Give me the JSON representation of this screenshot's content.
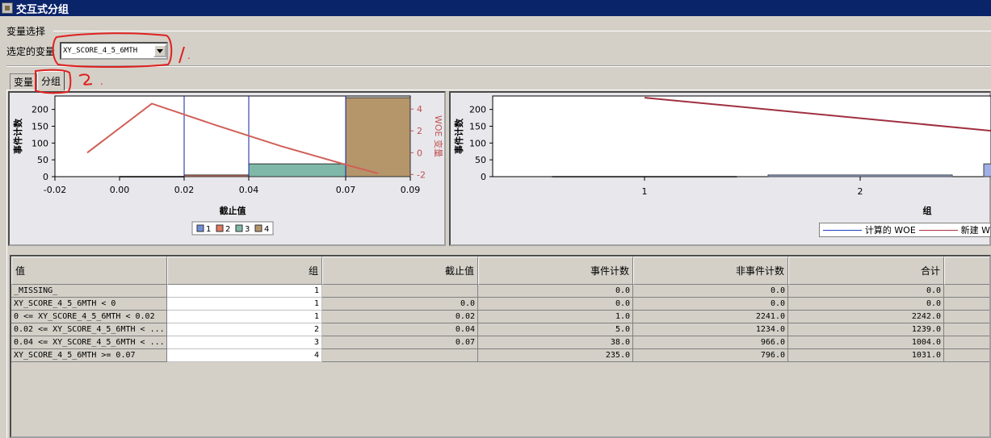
{
  "window": {
    "title": "交互式分组"
  },
  "variable_selection": {
    "group_label": "变量选择",
    "selected_label": "选定的变量",
    "selected_value": "XY_SCORE_4_5_6MTH"
  },
  "tabs": [
    {
      "label": "变量"
    },
    {
      "label": "分组",
      "active": true
    }
  ],
  "annotations": {
    "one": "1",
    "one_dot": ".",
    "two": "2",
    "two_dot": "."
  },
  "chart_data": [
    {
      "type": "bar",
      "chart": "event-count-by-cutoff",
      "ylabel": "事件计数",
      "y2label": "WOE 变量",
      "xlabel": "截止值",
      "x_ticks": [
        "-0.02",
        "0.00",
        "0.02",
        "0.04",
        "0.07",
        "0.09"
      ],
      "y_ticks": [
        "200",
        "150",
        "100",
        "50",
        "0"
      ],
      "y2_ticks": [
        "4",
        "2",
        "0",
        "-2"
      ],
      "ylim": [
        0,
        240
      ],
      "y2lim": [
        -2.2,
        5.2
      ],
      "bars": [
        {
          "group": "1",
          "x0": 0.0,
          "x1": 0.02,
          "value": 1,
          "color": "#6f8fd8"
        },
        {
          "group": "2",
          "x0": 0.02,
          "x1": 0.04,
          "value": 5,
          "color": "#e07a60"
        },
        {
          "group": "3",
          "x0": 0.04,
          "x1": 0.07,
          "value": 38,
          "color": "#7fb8a8"
        },
        {
          "group": "4",
          "x0": 0.07,
          "x1": 0.09,
          "value": 235,
          "color": "#b5956a"
        }
      ],
      "woe_line": {
        "x": [
          -0.01,
          0.01,
          0.03,
          0.05,
          0.07,
          0.08
        ],
        "y": [
          0.0,
          4.5,
          2.5,
          0.6,
          -1.1,
          -1.9
        ],
        "color": "#d06058"
      },
      "cutoff_lines": [
        0.02,
        0.04,
        0.07
      ],
      "legend": [
        "1",
        "2",
        "3",
        "4"
      ]
    },
    {
      "type": "bar",
      "chart": "event-count-by-group",
      "ylabel": "事件计数",
      "xlabel": "组",
      "categories": [
        "1",
        "2"
      ],
      "y_ticks": [
        "200",
        "150",
        "100",
        "50",
        "0"
      ],
      "ylim": [
        0,
        240
      ],
      "values": [
        1,
        5,
        38
      ],
      "bar_color": "#9eb0e6",
      "line": {
        "x": [
          1,
          3.4
        ],
        "y": [
          235,
          88
        ],
        "color": "#a03040"
      },
      "legend": [
        {
          "name": "计算的 WOE",
          "color": "#2040c0"
        },
        {
          "name": "新建 W",
          "color": "#b03040"
        }
      ]
    }
  ],
  "table": {
    "headers": [
      "值",
      "组",
      "截止值",
      "事件计数",
      "非事件计数",
      "合计"
    ],
    "rows": [
      [
        "_MISSING_",
        "1",
        "",
        "0.0",
        "0.0",
        "0.0"
      ],
      [
        "XY_SCORE_4_5_6MTH < 0",
        "1",
        "0.0",
        "0.0",
        "0.0",
        "0.0"
      ],
      [
        "0 <= XY_SCORE_4_5_6MTH < 0.02",
        "1",
        "0.02",
        "1.0",
        "2241.0",
        "2242.0"
      ],
      [
        "0.02 <= XY_SCORE_4_5_6MTH < ...",
        "2",
        "0.04",
        "5.0",
        "1234.0",
        "1239.0"
      ],
      [
        "0.04 <= XY_SCORE_4_5_6MTH < ...",
        "3",
        "0.07",
        "38.0",
        "966.0",
        "1004.0"
      ],
      [
        "XY_SCORE_4_5_6MTH >= 0.07",
        "4",
        "",
        "235.0",
        "796.0",
        "1031.0"
      ]
    ]
  }
}
